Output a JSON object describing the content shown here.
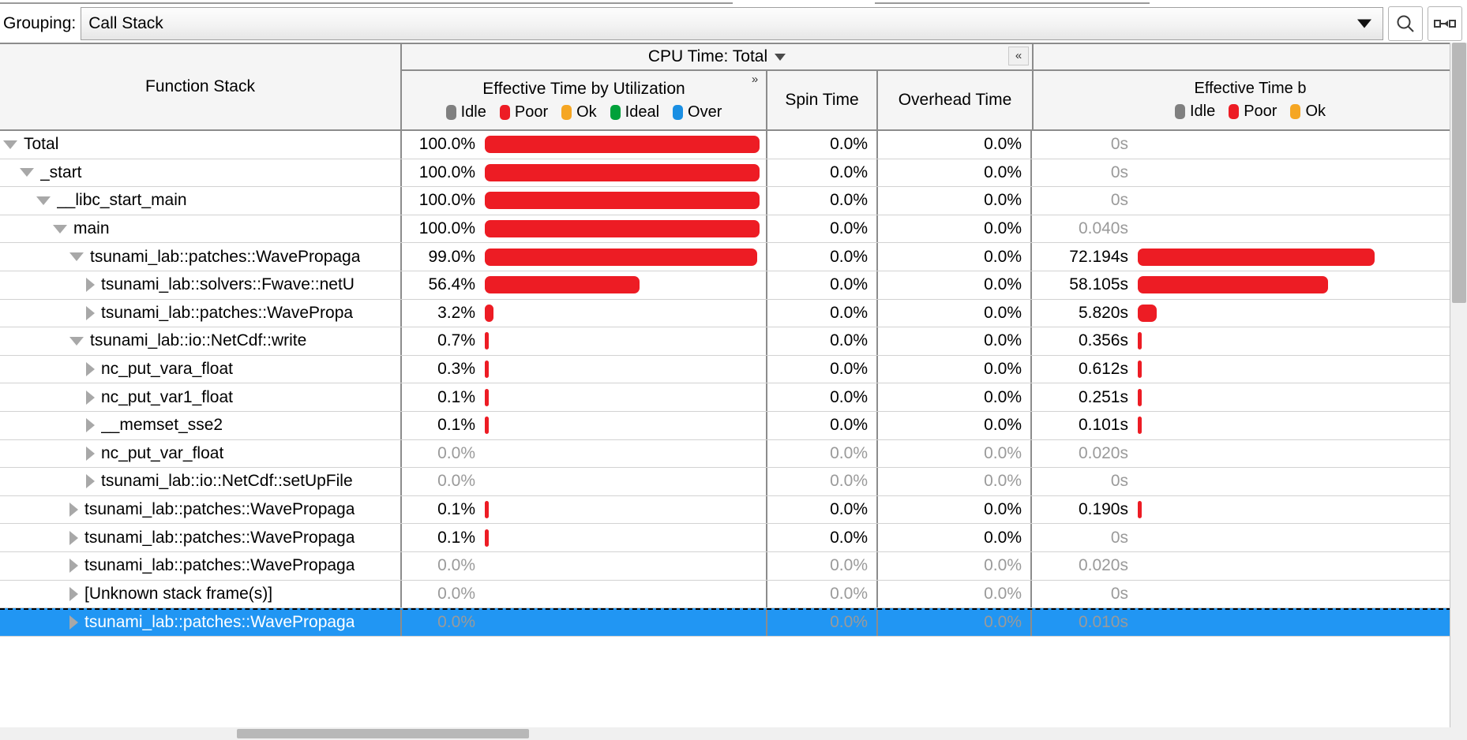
{
  "toolbar": {
    "grouping_label": "Grouping:",
    "grouping_value": "Call Stack",
    "search_icon": "search-icon",
    "fit_icon": "fit-columns-icon"
  },
  "grid": {
    "function_stack_header": "Function Stack",
    "cpu_time_group_header": "CPU Time: Total",
    "collapse_glyph": "«",
    "expand_glyph": "»",
    "columns": {
      "effective_time": "Effective Time by Utilization",
      "spin_time": "Spin Time",
      "overhead_time": "Overhead Time",
      "effective_time_right": "Effective Time b"
    },
    "legend": [
      {
        "label": "Idle",
        "color": "#808080"
      },
      {
        "label": "Poor",
        "color": "#ed1c24"
      },
      {
        "label": "Ok",
        "color": "#f5a623"
      },
      {
        "label": "Ideal",
        "color": "#00a13a"
      },
      {
        "label": "Over",
        "color": "#1a8fe3"
      }
    ],
    "legend_right": [
      {
        "label": "Idle",
        "color": "#808080"
      },
      {
        "label": "Poor",
        "color": "#ed1c24"
      },
      {
        "label": "Ok",
        "color": "#f5a623"
      }
    ]
  },
  "chart_data": {
    "type": "table",
    "title": "CPU Time: Total",
    "columns": [
      "Function Stack",
      "Effective Time by Utilization",
      "Spin Time",
      "Overhead Time",
      "Effective Time b"
    ],
    "rows": [
      {
        "depth": 0,
        "expander": "down",
        "name": "Total",
        "pct": "100.0%",
        "pct_value": 100.0,
        "pct_zero": false,
        "spin": "0.0%",
        "spin_zero": false,
        "ovh": "0.0%",
        "ovh_zero": false,
        "time": "0s",
        "time_zero": true,
        "time_value": 0,
        "selected": false
      },
      {
        "depth": 1,
        "expander": "down",
        "name": "_start",
        "pct": "100.0%",
        "pct_value": 100.0,
        "pct_zero": false,
        "spin": "0.0%",
        "spin_zero": false,
        "ovh": "0.0%",
        "ovh_zero": false,
        "time": "0s",
        "time_zero": true,
        "time_value": 0,
        "selected": false
      },
      {
        "depth": 2,
        "expander": "down",
        "name": "__libc_start_main",
        "pct": "100.0%",
        "pct_value": 100.0,
        "pct_zero": false,
        "spin": "0.0%",
        "spin_zero": false,
        "ovh": "0.0%",
        "ovh_zero": false,
        "time": "0s",
        "time_zero": true,
        "time_value": 0,
        "selected": false
      },
      {
        "depth": 3,
        "expander": "down",
        "name": "main",
        "pct": "100.0%",
        "pct_value": 100.0,
        "pct_zero": false,
        "spin": "0.0%",
        "spin_zero": false,
        "ovh": "0.0%",
        "ovh_zero": false,
        "time": "0.040s",
        "time_zero": true,
        "time_value": 0.04,
        "selected": false
      },
      {
        "depth": 4,
        "expander": "down",
        "name": "tsunami_lab::patches::WavePropaga",
        "pct": "99.0%",
        "pct_value": 99.0,
        "pct_zero": false,
        "spin": "0.0%",
        "spin_zero": false,
        "ovh": "0.0%",
        "ovh_zero": false,
        "time": "72.194s",
        "time_zero": false,
        "time_value": 72.194,
        "selected": false
      },
      {
        "depth": 5,
        "expander": "right",
        "name": "tsunami_lab::solvers::Fwave::netU",
        "pct": "56.4%",
        "pct_value": 56.4,
        "pct_zero": false,
        "spin": "0.0%",
        "spin_zero": false,
        "ovh": "0.0%",
        "ovh_zero": false,
        "time": "58.105s",
        "time_zero": false,
        "time_value": 58.105,
        "selected": false
      },
      {
        "depth": 5,
        "expander": "right",
        "name": "tsunami_lab::patches::WavePropa",
        "pct": "3.2%",
        "pct_value": 3.2,
        "pct_zero": false,
        "spin": "0.0%",
        "spin_zero": false,
        "ovh": "0.0%",
        "ovh_zero": false,
        "time": "5.820s",
        "time_zero": false,
        "time_value": 5.82,
        "selected": false
      },
      {
        "depth": 4,
        "expander": "down",
        "name": "tsunami_lab::io::NetCdf::write",
        "pct": "0.7%",
        "pct_value": 0.7,
        "pct_zero": false,
        "spin": "0.0%",
        "spin_zero": false,
        "ovh": "0.0%",
        "ovh_zero": false,
        "time": "0.356s",
        "time_zero": false,
        "time_value": 0.356,
        "selected": false
      },
      {
        "depth": 5,
        "expander": "right",
        "name": "nc_put_vara_float",
        "pct": "0.3%",
        "pct_value": 0.3,
        "pct_zero": false,
        "spin": "0.0%",
        "spin_zero": false,
        "ovh": "0.0%",
        "ovh_zero": false,
        "time": "0.612s",
        "time_zero": false,
        "time_value": 0.612,
        "selected": false
      },
      {
        "depth": 5,
        "expander": "right",
        "name": "nc_put_var1_float",
        "pct": "0.1%",
        "pct_value": 0.1,
        "pct_zero": false,
        "spin": "0.0%",
        "spin_zero": false,
        "ovh": "0.0%",
        "ovh_zero": false,
        "time": "0.251s",
        "time_zero": false,
        "time_value": 0.251,
        "selected": false
      },
      {
        "depth": 5,
        "expander": "right",
        "name": "__memset_sse2",
        "pct": "0.1%",
        "pct_value": 0.1,
        "pct_zero": false,
        "spin": "0.0%",
        "spin_zero": false,
        "ovh": "0.0%",
        "ovh_zero": false,
        "time": "0.101s",
        "time_zero": false,
        "time_value": 0.101,
        "selected": false
      },
      {
        "depth": 5,
        "expander": "right",
        "name": "nc_put_var_float",
        "pct": "0.0%",
        "pct_value": 0.0,
        "pct_zero": true,
        "spin": "0.0%",
        "spin_zero": true,
        "ovh": "0.0%",
        "ovh_zero": true,
        "time": "0.020s",
        "time_zero": true,
        "time_value": 0.02,
        "selected": false
      },
      {
        "depth": 5,
        "expander": "right",
        "name": "tsunami_lab::io::NetCdf::setUpFile",
        "pct": "0.0%",
        "pct_value": 0.0,
        "pct_zero": true,
        "spin": "0.0%",
        "spin_zero": true,
        "ovh": "0.0%",
        "ovh_zero": true,
        "time": "0s",
        "time_zero": true,
        "time_value": 0,
        "selected": false
      },
      {
        "depth": 4,
        "expander": "right",
        "name": "tsunami_lab::patches::WavePropaga",
        "pct": "0.1%",
        "pct_value": 0.1,
        "pct_zero": false,
        "spin": "0.0%",
        "spin_zero": false,
        "ovh": "0.0%",
        "ovh_zero": false,
        "time": "0.190s",
        "time_zero": false,
        "time_value": 0.19,
        "selected": false
      },
      {
        "depth": 4,
        "expander": "right",
        "name": "tsunami_lab::patches::WavePropaga",
        "pct": "0.1%",
        "pct_value": 0.1,
        "pct_zero": false,
        "spin": "0.0%",
        "spin_zero": false,
        "ovh": "0.0%",
        "ovh_zero": false,
        "time": "0s",
        "time_zero": true,
        "time_value": 0,
        "selected": false
      },
      {
        "depth": 4,
        "expander": "right",
        "name": "tsunami_lab::patches::WavePropaga",
        "pct": "0.0%",
        "pct_value": 0.0,
        "pct_zero": true,
        "spin": "0.0%",
        "spin_zero": true,
        "ovh": "0.0%",
        "ovh_zero": true,
        "time": "0.020s",
        "time_zero": true,
        "time_value": 0.02,
        "selected": false
      },
      {
        "depth": 4,
        "expander": "right",
        "name": "[Unknown stack frame(s)]",
        "pct": "0.0%",
        "pct_value": 0.0,
        "pct_zero": true,
        "spin": "0.0%",
        "spin_zero": true,
        "ovh": "0.0%",
        "ovh_zero": true,
        "time": "0s",
        "time_zero": true,
        "time_value": 0,
        "selected": false
      },
      {
        "depth": 4,
        "expander": "right",
        "name": "tsunami_lab::patches::WavePropaga",
        "pct": "0.0%",
        "pct_value": 0.0,
        "pct_zero": true,
        "spin": "0.0%",
        "spin_zero": true,
        "ovh": "0.0%",
        "ovh_zero": true,
        "time": "0.010s",
        "time_zero": true,
        "time_value": 0.01,
        "selected": true
      }
    ]
  }
}
